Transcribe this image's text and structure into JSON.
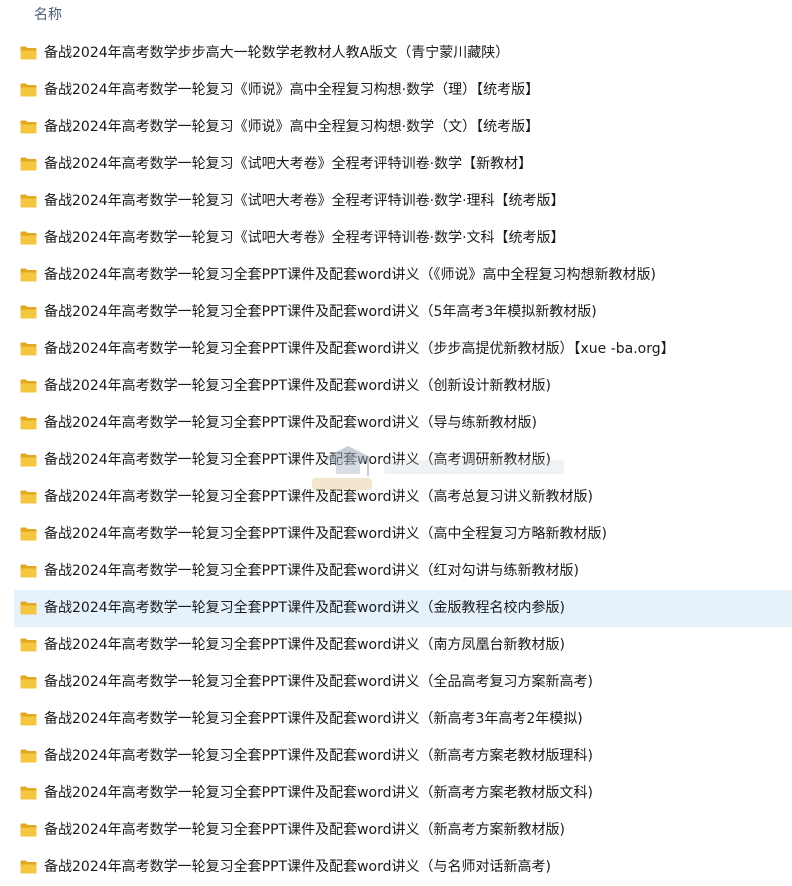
{
  "header": {
    "column_name": "名称",
    "sort_caret": "^"
  },
  "colors": {
    "folder": "#f5c640",
    "folder_dark": "#e2a820",
    "selected_row": "#e5f1fb",
    "header_text": "#4c607a"
  },
  "files": [
    {
      "name": "备战2024年高考数学步步高大一轮数学老教材人教A版文（青宁蒙川藏陕）",
      "icon": "folder-icon",
      "selected": false
    },
    {
      "name": "备战2024年高考数学一轮复习《师说》高中全程复习构想·数学（理）【统考版】",
      "icon": "folder-icon",
      "selected": false
    },
    {
      "name": "备战2024年高考数学一轮复习《师说》高中全程复习构想·数学（文）【统考版】",
      "icon": "folder-icon",
      "selected": false
    },
    {
      "name": "备战2024年高考数学一轮复习《试吧大考卷》全程考评特训卷·数学【新教材】",
      "icon": "folder-icon",
      "selected": false
    },
    {
      "name": "备战2024年高考数学一轮复习《试吧大考卷》全程考评特训卷·数学·理科【统考版】",
      "icon": "folder-icon",
      "selected": false
    },
    {
      "name": "备战2024年高考数学一轮复习《试吧大考卷》全程考评特训卷·数学·文科【统考版】",
      "icon": "folder-icon",
      "selected": false
    },
    {
      "name": "备战2024年高考数学一轮复习全套PPT课件及配套word讲义（《师说》高中全程复习构想新教材版)",
      "icon": "folder-icon",
      "selected": false
    },
    {
      "name": "备战2024年高考数学一轮复习全套PPT课件及配套word讲义（5年高考3年模拟新教材版)",
      "icon": "folder-icon",
      "selected": false
    },
    {
      "name": "备战2024年高考数学一轮复习全套PPT课件及配套word讲义（步步高提优新教材版）【xue -ba.org】",
      "icon": "folder-icon",
      "selected": false
    },
    {
      "name": "备战2024年高考数学一轮复习全套PPT课件及配套word讲义（创新设计新教材版)",
      "icon": "folder-icon",
      "selected": false
    },
    {
      "name": "备战2024年高考数学一轮复习全套PPT课件及配套word讲义（导与练新教材版)",
      "icon": "folder-icon",
      "selected": false
    },
    {
      "name": "备战2024年高考数学一轮复习全套PPT课件及配套word讲义（高考调研新教材版)",
      "icon": "folder-icon",
      "selected": false
    },
    {
      "name": "备战2024年高考数学一轮复习全套PPT课件及配套word讲义（高考总复习讲义新教材版)",
      "icon": "folder-icon",
      "selected": false
    },
    {
      "name": "备战2024年高考数学一轮复习全套PPT课件及配套word讲义（高中全程复习方略新教材版)",
      "icon": "folder-icon",
      "selected": false
    },
    {
      "name": "备战2024年高考数学一轮复习全套PPT课件及配套word讲义（红对勾讲与练新教材版)",
      "icon": "folder-icon",
      "selected": false
    },
    {
      "name": "备战2024年高考数学一轮复习全套PPT课件及配套word讲义（金版教程名校内参版)",
      "icon": "folder-icon",
      "selected": true
    },
    {
      "name": "备战2024年高考数学一轮复习全套PPT课件及配套word讲义（南方凤凰台新教材版)",
      "icon": "folder-icon",
      "selected": false
    },
    {
      "name": "备战2024年高考数学一轮复习全套PPT课件及配套word讲义（全品高考复习方案新高考)",
      "icon": "folder-icon",
      "selected": false
    },
    {
      "name": "备战2024年高考数学一轮复习全套PPT课件及配套word讲义（新高考3年高考2年模拟)",
      "icon": "folder-icon",
      "selected": false
    },
    {
      "name": "备战2024年高考数学一轮复习全套PPT课件及配套word讲义（新高考方案老教材版理科)",
      "icon": "folder-icon",
      "selected": false
    },
    {
      "name": "备战2024年高考数学一轮复习全套PPT课件及配套word讲义（新高考方案老教材版文科)",
      "icon": "folder-icon",
      "selected": false
    },
    {
      "name": "备战2024年高考数学一轮复习全套PPT课件及配套word讲义（新高考方案新教材版)",
      "icon": "folder-icon",
      "selected": false
    },
    {
      "name": "备战2024年高考数学一轮复习全套PPT课件及配套word讲义（与名师对话新高考)",
      "icon": "folder-icon",
      "selected": false
    }
  ]
}
